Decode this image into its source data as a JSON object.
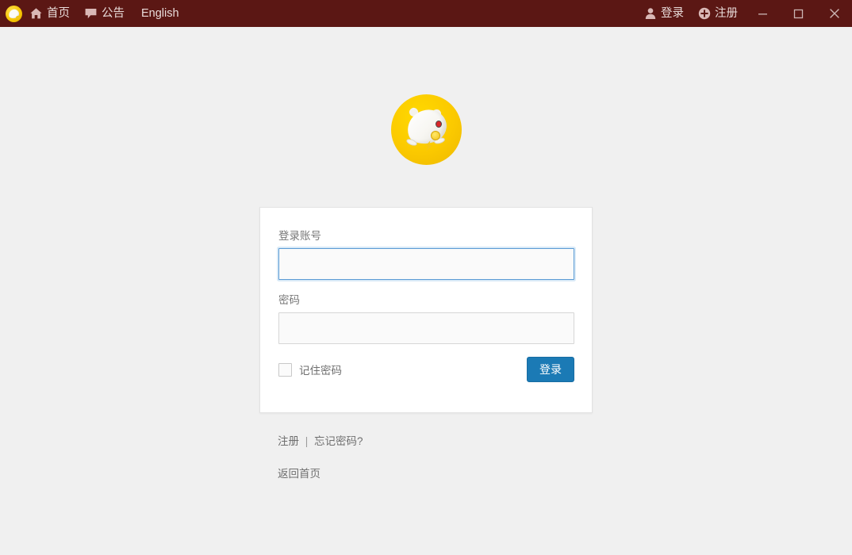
{
  "titlebar": {
    "app_icon": "app-logo-icon",
    "background_color": "#5b1714",
    "nav": [
      {
        "icon": "home-icon",
        "label": "首页"
      },
      {
        "icon": "speech-bubble-icon",
        "label": "公告"
      },
      {
        "icon": "",
        "label": "English"
      }
    ],
    "account_actions": [
      {
        "icon": "user-icon",
        "label": "登录"
      },
      {
        "icon": "plus-circle-icon",
        "label": "注册"
      }
    ],
    "window_controls": [
      {
        "name": "minimize",
        "glyph": "—"
      },
      {
        "name": "maximize",
        "glyph": "□"
      },
      {
        "name": "close",
        "glyph": "✕"
      }
    ]
  },
  "brand": {
    "logo_name": "hamster-logo",
    "logo_circle_color": "#fbc900"
  },
  "login_form": {
    "username": {
      "label": "登录账号",
      "value": "",
      "placeholder": "",
      "focused": true
    },
    "password": {
      "label": "密码",
      "value": "",
      "placeholder": "",
      "focused": false
    },
    "remember": {
      "label": "记住密码",
      "checked": false
    },
    "submit_label": "登录",
    "submit_color": "#1b7ab5"
  },
  "footer": {
    "register_label": "注册",
    "separator": "|",
    "forgot_label": "忘记密码?",
    "home_label": "返回首页"
  }
}
